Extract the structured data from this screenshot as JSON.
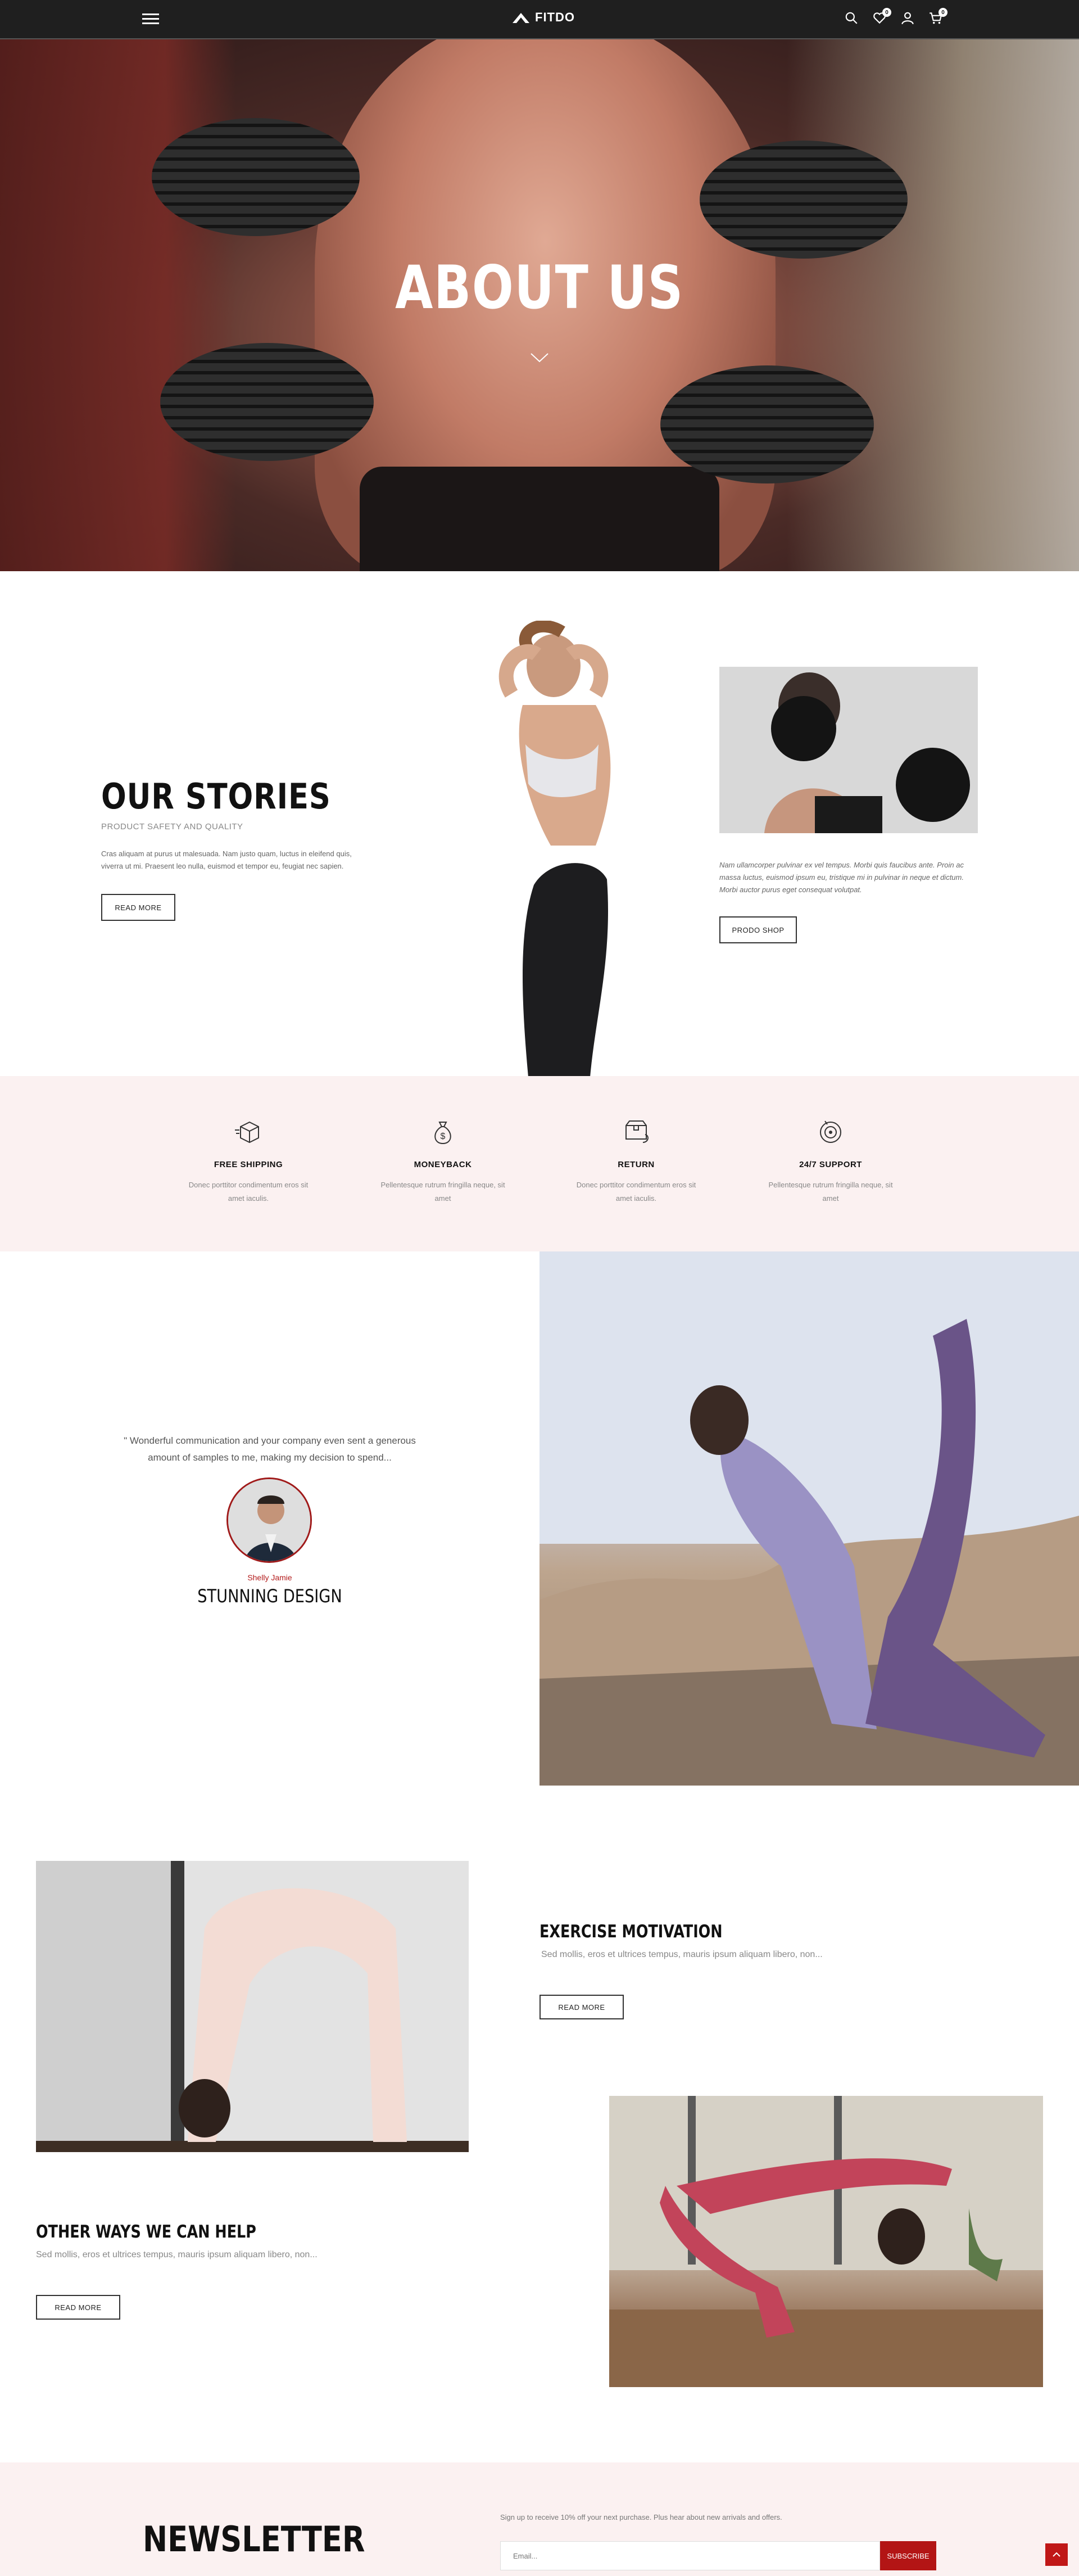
{
  "header": {
    "brand": "FITDO",
    "wishlist_count": "0",
    "cart_count": "0",
    "icons": [
      "menu-icon",
      "search-icon",
      "heart-icon",
      "user-icon",
      "cart-icon"
    ]
  },
  "hero": {
    "title": "ABOUT US"
  },
  "stories": {
    "title": "OUR STORIES",
    "subtitle": "PRODUCT SAFETY AND QUALITY",
    "text": "Cras aliquam at purus ut malesuada. Nam justo quam, luctus in eleifend quis, viverra ut mi. Praesent leo nulla, euismod et tempor eu, feugiat nec sapien.",
    "button": "READ MORE",
    "side_text": "Nam ullamcorper pulvinar ex vel tempus. Morbi quis faucibus ante. Proin ac massa luctus, euismod ipsum eu, tristique mi in pulvinar in neque et dictum. Morbi auctor purus eget consequat volutpat.",
    "side_button": "PRODO SHOP"
  },
  "features": [
    {
      "icon": "box-icon",
      "title": "FREE SHIPPING",
      "text": "Donec porttitor condimentum eros sit amet iaculis."
    },
    {
      "icon": "money-bag-icon",
      "title": "MONEYBACK",
      "text": "Pellentesque rutrum fringilla neque, sit amet"
    },
    {
      "icon": "return-icon",
      "title": "RETURN",
      "text": "Donec porttitor condimentum eros sit amet iaculis."
    },
    {
      "icon": "support-icon",
      "title": "24/7 SUPPORT",
      "text": "Pellentesque rutrum fringilla neque, sit amet"
    }
  ],
  "testimonial": {
    "quote": "\" Wonderful communication and your company even sent a generous amount of samples to me, making my decision to spend...",
    "name": "Shelly Jamie",
    "title": "STUNNING DESIGN"
  },
  "exercise": {
    "title": "EXERCISE MOTIVATION",
    "text": "Sed mollis, eros et ultrices tempus, mauris ipsum aliquam libero, non...",
    "button": "READ MORE"
  },
  "other_ways": {
    "title": "OTHER WAYS WE CAN HELP",
    "text": "Sed mollis, eros et ultrices tempus, mauris ipsum aliquam libero, non...",
    "button": "READ MORE"
  },
  "newsletter": {
    "title": "NEWSLETTER",
    "text": "Sign up to receive 10% off your next purchase. Plus hear about new arrivals and offers.",
    "placeholder": "Email...",
    "button": "SUBSCRIBE"
  },
  "colors": {
    "accent": "#b31515",
    "header_bg": "#1f1f1f",
    "section_pink": "#fbf1f1"
  }
}
